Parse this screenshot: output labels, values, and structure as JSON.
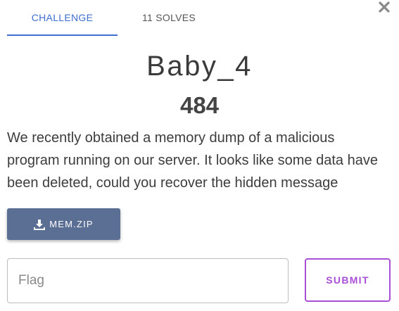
{
  "tabs": [
    {
      "label": "CHALLENGE",
      "active": true
    },
    {
      "label": "11 SOLVES",
      "active": false
    }
  ],
  "close_icon": "close-icon",
  "challenge": {
    "name": "Baby_4",
    "points": "484",
    "description": "We recently obtained a memory dump of a malicious program running on our server. It looks like some data have been deleted, could you recover the hidden message"
  },
  "download": {
    "label": "MEM.ZIP",
    "icon": "download-icon"
  },
  "flag": {
    "placeholder": "Flag",
    "value": ""
  },
  "submit": {
    "label": "SUBMIT"
  },
  "colors": {
    "accent": "#3f6fd0",
    "download_bg": "#5b6f94",
    "submit": "#a94fd6"
  }
}
